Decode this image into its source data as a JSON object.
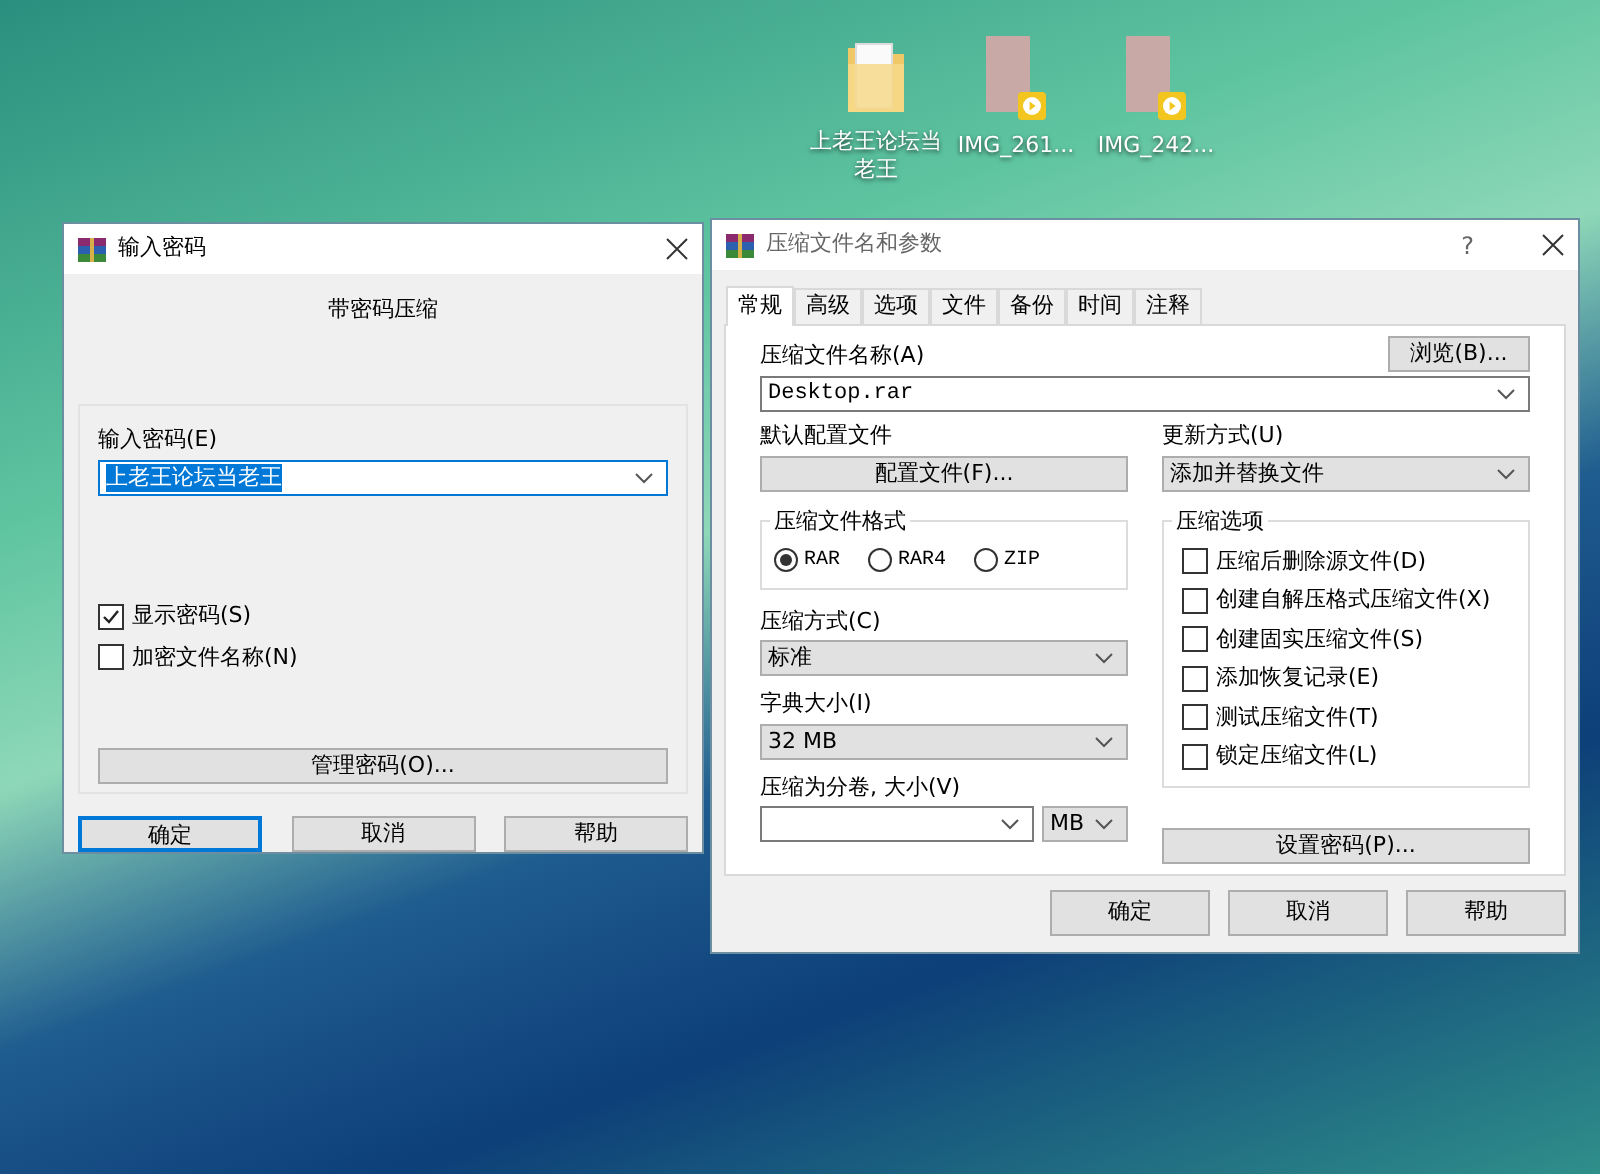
{
  "desktop_icons": [
    {
      "kind": "folder",
      "label": "上老王论坛当老王"
    },
    {
      "kind": "video",
      "label": "IMG_261..."
    },
    {
      "kind": "video",
      "label": "IMG_242..."
    }
  ],
  "password_dialog": {
    "title": "输入密码",
    "heading": "带密码压缩",
    "password_label": "输入密码(E)",
    "password_value": "上老王论坛当老王",
    "checkboxes": [
      {
        "label": "显示密码(S)",
        "checked": true
      },
      {
        "label": "加密文件名称(N)",
        "checked": false
      }
    ],
    "manage_button": "管理密码(O)...",
    "buttons": [
      {
        "label": "确定",
        "default": true
      },
      {
        "label": "取消",
        "default": false
      },
      {
        "label": "帮助",
        "default": false
      }
    ]
  },
  "archive_dialog": {
    "title": "压缩文件名和参数",
    "help": "?",
    "tabs": [
      {
        "label": "常规",
        "selected": true
      },
      {
        "label": "高级",
        "selected": false
      },
      {
        "label": "选项",
        "selected": false
      },
      {
        "label": "文件",
        "selected": false
      },
      {
        "label": "备份",
        "selected": false
      },
      {
        "label": "时间",
        "selected": false
      },
      {
        "label": "注释",
        "selected": false
      }
    ],
    "archive_name_label": "压缩文件名称(A)",
    "browse_button": "浏览(B)...",
    "archive_name_value": "Desktop.rar",
    "profile_label": "默认配置文件",
    "profile_button": "配置文件(F)...",
    "update_label": "更新方式(U)",
    "update_value": "添加并替换文件",
    "format_group": {
      "title": "压缩文件格式",
      "options": [
        {
          "label": "RAR",
          "selected": true
        },
        {
          "label": "RAR4",
          "selected": false
        },
        {
          "label": "ZIP",
          "selected": false
        }
      ]
    },
    "method_label": "压缩方式(C)",
    "method_value": "标准",
    "dictionary_label": "字典大小(I)",
    "dictionary_value": "32 MB",
    "volume_label": "压缩为分卷, 大小(V)",
    "volume_unit": "MB",
    "options_group": {
      "title": "压缩选项",
      "checkboxes": [
        {
          "label": "压缩后删除源文件(D)",
          "checked": false
        },
        {
          "label": "创建自解压格式压缩文件(X)",
          "checked": false
        },
        {
          "label": "创建固实压缩文件(S)",
          "checked": false
        },
        {
          "label": "添加恢复记录(E)",
          "checked": false
        },
        {
          "label": "测试压缩文件(T)",
          "checked": false
        },
        {
          "label": "锁定压缩文件(L)",
          "checked": false
        }
      ]
    },
    "set_password_button": "设置密码(P)...",
    "buttons": [
      {
        "label": "确定",
        "default": false
      },
      {
        "label": "取消",
        "default": false
      },
      {
        "label": "帮助",
        "default": false
      }
    ]
  }
}
